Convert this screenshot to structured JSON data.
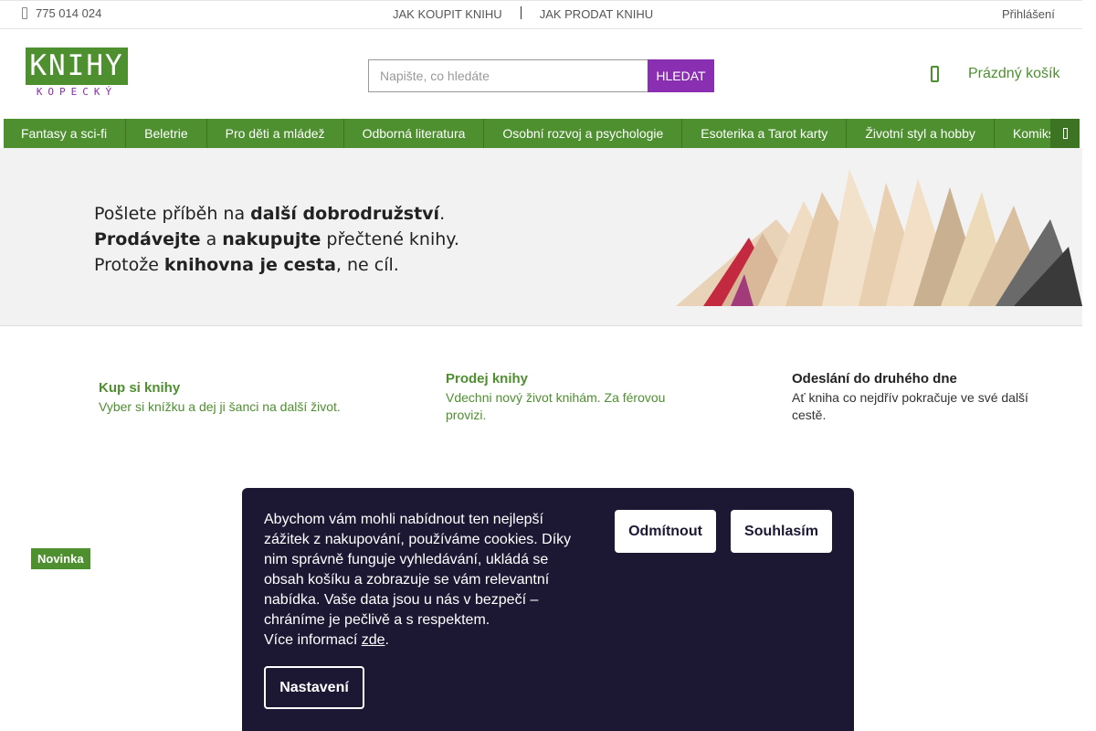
{
  "topbar": {
    "phone": "775 014 024",
    "phone_icon": "phone-icon",
    "nav": [
      "JAK KOUPIT KNIHU",
      "JAK PRODAT KNIHU"
    ],
    "login": "Přihlášení"
  },
  "logo": {
    "top": "KNIHY",
    "bottom": "KOPECKÝ"
  },
  "search": {
    "placeholder": "Napište, co hledáte",
    "button": "HLEDAT"
  },
  "cart": {
    "label": "Prázdný košík",
    "icon": "cart-icon"
  },
  "categories": [
    "Fantasy a sci-fi",
    "Beletrie",
    "Pro děti a mládež",
    "Odborná literatura",
    "Osobní rozvoj a psychologie",
    "Esoterika a Tarot karty",
    "Životní styl a hobby",
    "Komiks"
  ],
  "banner": {
    "line1": {
      "a": "Pošlete příběh na ",
      "b": "další dobrodružství",
      "c": "."
    },
    "line2": {
      "a": "Prodávejte",
      "b": " a ",
      "c": "nakupujte",
      "d": " přečtené knihy."
    },
    "line3": {
      "a": "Protože ",
      "b": "knihovna je cesta",
      "c": ", ne cíl."
    }
  },
  "features": [
    {
      "title": "Kup si knihy",
      "text": "Vyber si knížku a dej ji šanci na další život."
    },
    {
      "title": "Prodej knihy",
      "text": "Vdechni nový život knihám. Za férovou provizi."
    },
    {
      "title": "Odeslání do druhého dne",
      "text": "Ať kniha co nejdřív pokračuje ve své další cestě."
    }
  ],
  "badge": "Novinka",
  "cookie": {
    "text": "Abychom vám mohli nabídnout ten nejlepší zážitek z nakupování, používáme cookies. Díky nim správně funguje vyhledávání, ukládá se obsah košíku a zobrazuje se vám relevantní nabídka. Vaše data jsou u nás v bezpečí – chráníme je pečlivě a s respektem.",
    "more_prefix": "Více informací ",
    "more_link": "zde",
    "more_suffix": ".",
    "decline": "Odmítnout",
    "accept": "Souhlasím",
    "settings": "Nastavení"
  },
  "colors": {
    "brand_green": "#4e8f2f",
    "search_purple": "#8b2fb2",
    "cookie_bg": "#1c1733"
  }
}
